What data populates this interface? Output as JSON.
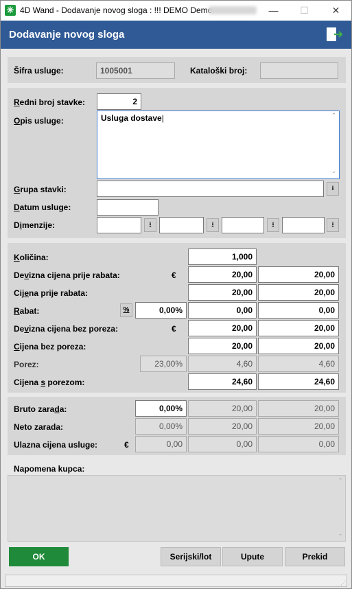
{
  "window": {
    "title": "4D Wand - Dodavanje novog sloga : !!! DEMO Demo",
    "minimize": "—",
    "maximize": "☐",
    "close": "✕"
  },
  "header": {
    "title": "Dodavanje novog sloga"
  },
  "top": {
    "sifra_label": "Šifra usluge:",
    "sifra_value": "1005001",
    "katalog_label": "Kataloški broj:",
    "katalog_value": ""
  },
  "details": {
    "redni_label": "Redni broj stavke:",
    "redni_value": "2",
    "opis_label": "Opis usluge:",
    "opis_value": "Usluga dostave",
    "grupa_label": "Grupa stavki:",
    "grupa_value": "",
    "datum_label": "Datum usluge:",
    "datum_value": "",
    "dimenzije_label": "Dimenzije:",
    "dimenzije_values": [
      "",
      "",
      "",
      ""
    ]
  },
  "prices": {
    "kolicina_label": "Količina:",
    "kolicina_value": "1,000",
    "devizna_label": "Devizna cijena prije rabata:",
    "devizna_currency": "€",
    "devizna_values": [
      "20,00",
      "20,00"
    ],
    "cijena_label": "Cijena prije rabata:",
    "cijena_values": [
      "20,00",
      "20,00"
    ],
    "rabat_label": "Rabat:",
    "rabat_pct_btn": "%",
    "rabat_pct": "0,00%",
    "rabat_values": [
      "0,00",
      "0,00"
    ],
    "devizna_bez_label": "Devizna cijena bez poreza:",
    "devizna_bez_currency": "€",
    "devizna_bez_values": [
      "20,00",
      "20,00"
    ],
    "cijena_bez_label": "Cijena bez poreza:",
    "cijena_bez_values": [
      "20,00",
      "20,00"
    ],
    "porez_label": "Porez:",
    "porez_pct": "23,00%",
    "porez_values": [
      "4,60",
      "4,60"
    ],
    "cijena_s_label": "Cijena s porezom:",
    "cijena_s_values": [
      "24,60",
      "24,60"
    ]
  },
  "margins": {
    "bruto_label": "Bruto zarada:",
    "bruto_values": [
      "0,00%",
      "20,00",
      "20,00"
    ],
    "neto_label": "Neto zarada:",
    "neto_values": [
      "0,00%",
      "20,00",
      "20,00"
    ],
    "ulazna_label": "Ulazna cijena usluge:",
    "ulazna_currency": "€",
    "ulazna_values": [
      "0,00",
      "0,00",
      "0,00"
    ]
  },
  "napomena": {
    "label": "Napomena kupca:",
    "value": ""
  },
  "buttons": {
    "ok": "OK",
    "serijski": "Serijski/lot",
    "upute": "Upute",
    "prekid": "Prekid"
  },
  "colors": {
    "header": "#2f5a96",
    "ok": "#1e8a3a"
  }
}
